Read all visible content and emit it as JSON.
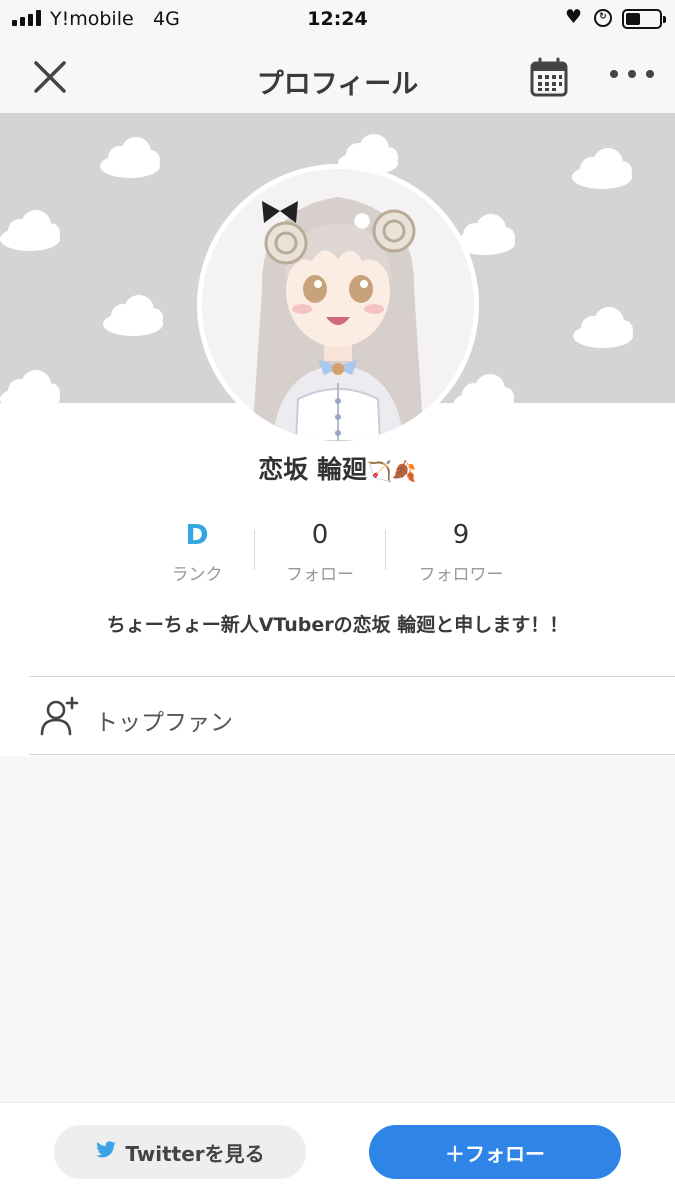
{
  "status_bar": {
    "carrier": "Y!mobile",
    "network": "4G",
    "time": "12:24",
    "battery_level": 0.45
  },
  "nav": {
    "title": "プロフィール",
    "close_icon": "close-icon",
    "calendar_icon": "calendar-icon",
    "more_icon": "more-icon"
  },
  "profile": {
    "name": "恋坂 輪廻",
    "name_emoji": "🏹🍂",
    "bio": "ちょーちょー新人VTuberの恋坂 輪廻と申します！！"
  },
  "stats": {
    "rank": {
      "value": "D",
      "label": "ランク"
    },
    "follow": {
      "value": "0",
      "label": "フォロー"
    },
    "followers": {
      "value": "9",
      "label": "フォロワー"
    }
  },
  "top_fan": {
    "label": "トップファン",
    "icon": "add-user-icon"
  },
  "actions": {
    "twitter_label": "Twitterを見る",
    "follow_label": "＋フォロー"
  },
  "colors": {
    "rank": "#35a7e0",
    "follow_button": "#2f84e8",
    "cover": "#d4d4d4"
  }
}
